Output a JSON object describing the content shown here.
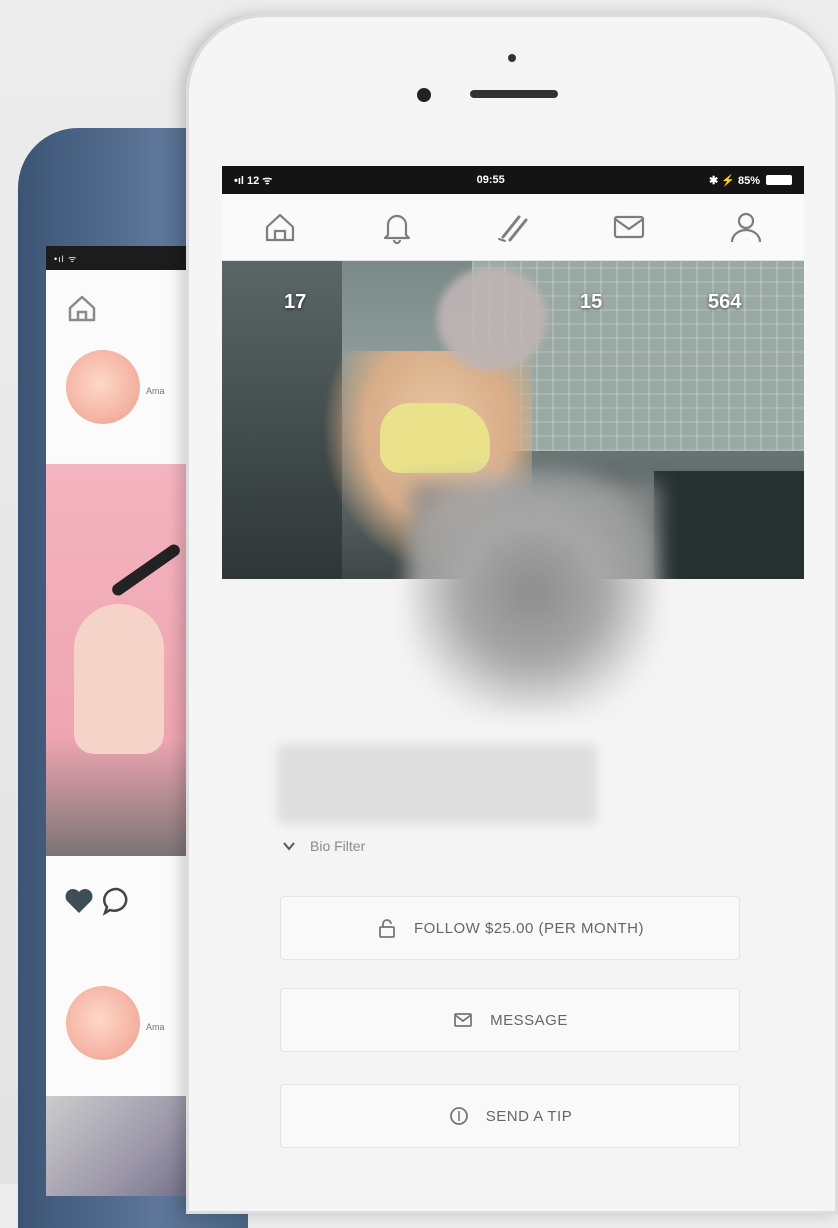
{
  "back_phone": {
    "status_text": "•ıl ᯤ",
    "post_author_1": "Ama",
    "post_author_2": "Ama"
  },
  "status_bar": {
    "carrier": "•ıl 12 ᯤ",
    "time": "09:55",
    "battery_text": "✱ ⚡ 85%"
  },
  "nav": {
    "items": [
      {
        "name": "home",
        "icon": "home-icon"
      },
      {
        "name": "notifications",
        "icon": "bell-icon"
      },
      {
        "name": "create",
        "icon": "compose-icon"
      },
      {
        "name": "messages",
        "icon": "mail-icon"
      },
      {
        "name": "profile",
        "icon": "user-icon"
      }
    ]
  },
  "profile": {
    "stats": [
      "17",
      "15",
      "564"
    ],
    "bio_toggle_label": "Bio Filter"
  },
  "actions": {
    "follow_label": "FOLLOW $25.00 (PER MONTH)",
    "message_label": "MESSAGE",
    "tip_label": "SEND A TIP"
  },
  "colors": {
    "back_phone_frame": "#4a6384",
    "screen_bg": "#f4f4f4",
    "button_text": "#666666"
  }
}
